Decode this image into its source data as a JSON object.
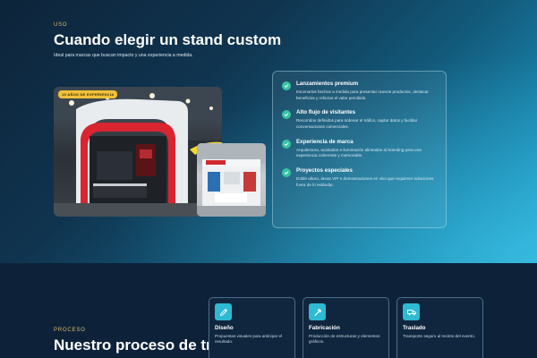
{
  "use_section": {
    "eyebrow": "USO",
    "title": "Cuando elegir un stand custom",
    "lead": "Ideal para marcas que buscan impacto y una experiencia a medida.",
    "photo_badge": "15 AÑOS DE EXPERIENCIA",
    "features": [
      {
        "title": "Lanzamientos premium",
        "desc": "Escenarios hechos a medida para presentar nuevos productos, destacar beneficios y reforzar el valor percibido.",
        "icon": "check-icon"
      },
      {
        "title": "Alto flujo de visitantes",
        "desc": "Recorridos definidos para ordenar el tráfico, captar datos y facilitar conversaciones comerciales.",
        "icon": "check-icon"
      },
      {
        "title": "Experiencia de marca",
        "desc": "Arquitectura, acabados e iluminación alineados al branding para una experiencia coherente y memorable.",
        "icon": "check-icon"
      },
      {
        "title": "Proyectos especiales",
        "desc": "Doble altura, áreas VIP o demostraciones en vivo que requieren soluciones fuera de lo estándar.",
        "icon": "check-icon"
      }
    ]
  },
  "process_section": {
    "eyebrow": "PROCESO",
    "title": "Nuestro proceso de trabajo",
    "steps": [
      {
        "title": "Diseño",
        "desc": "Propuestas visuales para anticipar el resultado.",
        "icon": "pencil-icon"
      },
      {
        "title": "Fabricación",
        "desc": "Producción de estructuras y elementos gráficos.",
        "icon": "hammer-icon"
      },
      {
        "title": "Traslado",
        "desc": "Transporte seguro al recinto del evento.",
        "icon": "truck-icon"
      }
    ]
  },
  "colors": {
    "accent_gold": "#e0b968",
    "check_green": "#37c4a4",
    "step_icon_teal": "#2dbad2",
    "badge_yellow": "#f0c23a"
  }
}
